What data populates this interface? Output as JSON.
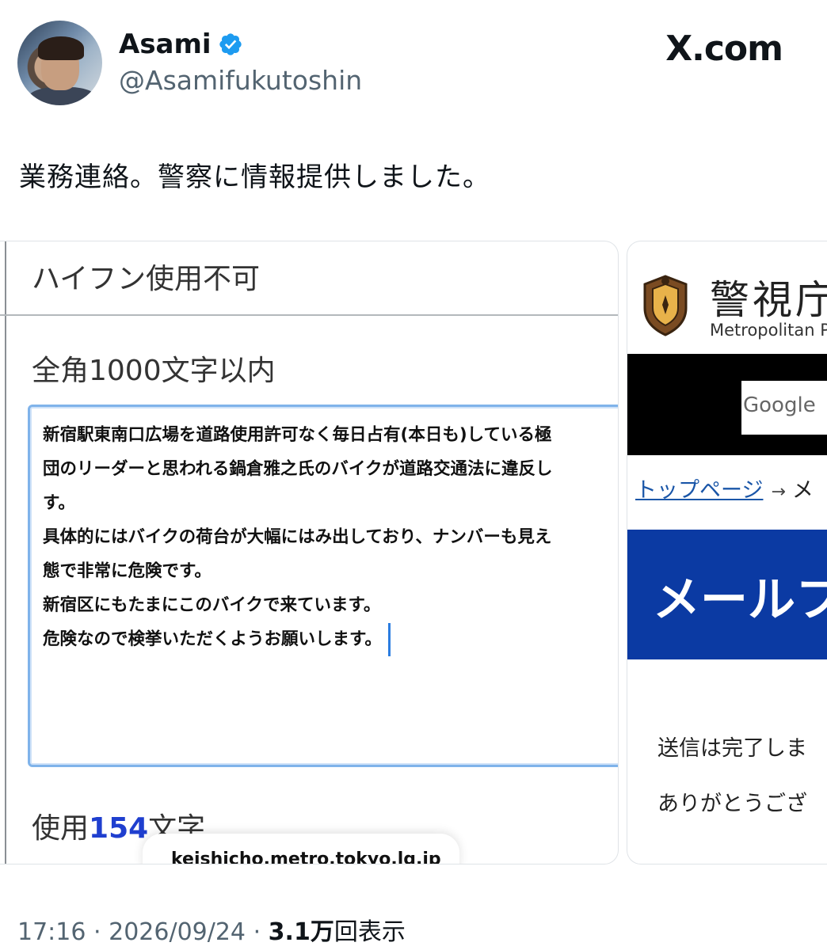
{
  "author": {
    "name": "Asami",
    "handle": "@Asamifukutoshin",
    "verified": true,
    "avatar_icon": "profile-photo"
  },
  "brand": "X.com",
  "tweet": {
    "text": "業務連絡。警察に情報提供しました。"
  },
  "form_screenshot": {
    "hyphen_note": "ハイフン使用不可",
    "limit_note": "全角1000文字以内",
    "message_lines": [
      "新宿駅東南口広場を道路使用許可なく毎日占有(本日も)している極",
      "団のリーダーと思われる鍋倉雅之氏のバイクが道路交通法に違反し",
      "す。",
      "具体的にはバイクの荷台が大幅にはみ出しており、ナンバーも見え",
      "態で非常に危険です。",
      "新宿区にもたまにこのバイクで来ています。",
      "危険なので検挙いただくようお願いします。"
    ],
    "count_prefix": "使用",
    "count_value": "154",
    "count_suffix": "文字",
    "url": "keishicho.metro.tokyo.lg.jp"
  },
  "police_screenshot": {
    "title": "警視庁",
    "subtitle": "Metropolitan P",
    "google": "Google",
    "breadcrumb_home": "トップページ",
    "breadcrumb_arrow": "→",
    "breadcrumb_next": "メ",
    "heading": "メールフ",
    "sent_text": "送信は完了しま",
    "thanks_text": "ありがとうござ"
  },
  "meta": {
    "time": "17:16",
    "separator": "·",
    "date": "2026/09/24",
    "views_value": "3.1万",
    "views_label": "回表示"
  }
}
